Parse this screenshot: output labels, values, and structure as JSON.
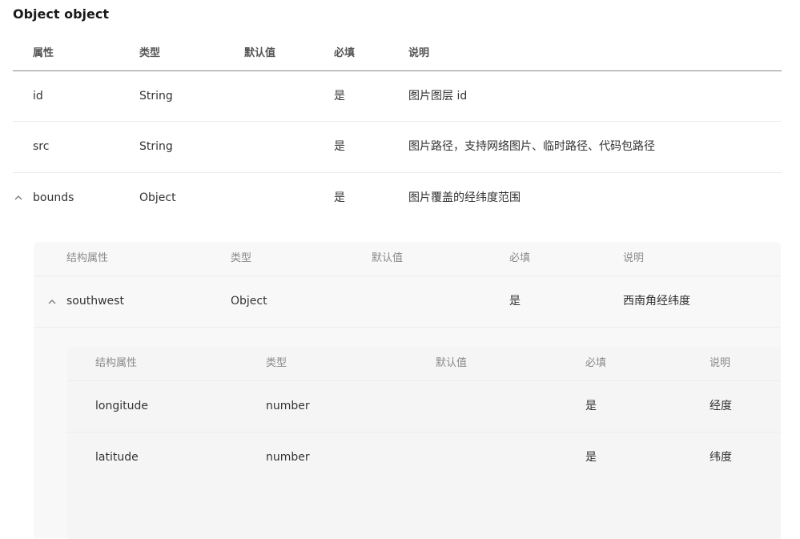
{
  "title": "Object object",
  "main_table": {
    "headers": [
      "属性",
      "类型",
      "默认值",
      "必填",
      "说明"
    ],
    "rows": [
      {
        "name": "id",
        "type": "String",
        "default": "",
        "required": "是",
        "desc": "图片图层 id"
      },
      {
        "name": "src",
        "type": "String",
        "default": "",
        "required": "是",
        "desc": "图片路径，支持网络图片、临时路径、代码包路径"
      },
      {
        "name": "bounds",
        "type": "Object",
        "default": "",
        "required": "是",
        "desc": "图片覆盖的经纬度范围"
      }
    ]
  },
  "bounds_table": {
    "headers": [
      "结构属性",
      "类型",
      "默认值",
      "必填",
      "说明"
    ],
    "rows": [
      {
        "name": "southwest",
        "type": "Object",
        "default": "",
        "required": "是",
        "desc": "西南角经纬度"
      }
    ]
  },
  "southwest_table": {
    "headers": [
      "结构属性",
      "类型",
      "默认值",
      "必填",
      "说明"
    ],
    "rows": [
      {
        "name": "longitude",
        "type": "number",
        "default": "",
        "required": "是",
        "desc": "经度"
      },
      {
        "name": "latitude",
        "type": "number",
        "default": "",
        "required": "是",
        "desc": "纬度"
      }
    ]
  },
  "icons": {
    "expand_collapse": "chevron-up-icon"
  }
}
